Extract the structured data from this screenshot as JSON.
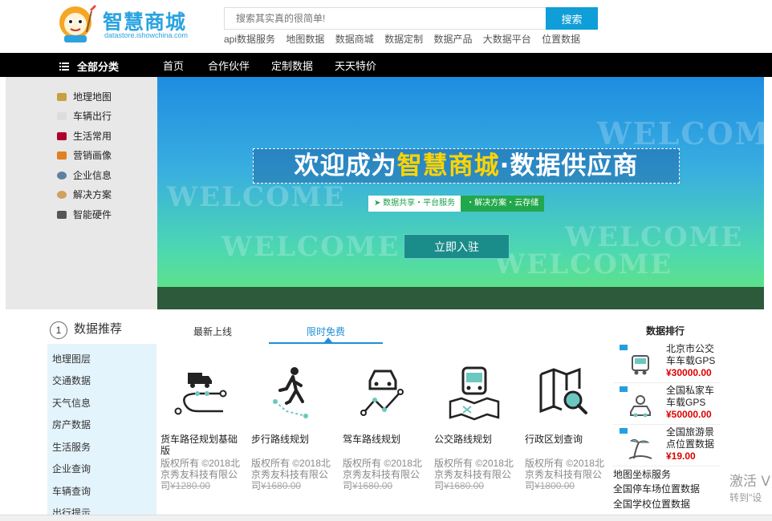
{
  "header": {
    "brand": "智慧商城",
    "domain": "datastore.ishowchina.com",
    "search_placeholder": "搜索其实真的很简单!",
    "search_button": "搜索",
    "hot_links": [
      "api数据服务",
      "地图数据",
      "数据商城",
      "数据定制",
      "数据产品",
      "大数据平台",
      "位置数据"
    ]
  },
  "nav": {
    "all_categories": "全部分类",
    "items": [
      "首页",
      "合作伙伴",
      "定制数据",
      "天天特价"
    ]
  },
  "categories": [
    {
      "label": "地理地图",
      "color": "#c8a040"
    },
    {
      "label": "车辆出行",
      "color": "#dddddd"
    },
    {
      "label": "生活常用",
      "color": "#b0002a"
    },
    {
      "label": "营销画像",
      "color": "#e08020"
    },
    {
      "label": "企业信息",
      "color": "#6080a0"
    },
    {
      "label": "解决方案",
      "color": "#d0a060"
    },
    {
      "label": "智能硬件",
      "color": "#555555"
    }
  ],
  "banner": {
    "watermark": "WELCOME",
    "headline_pre": "欢迎成为",
    "headline_highlight": "智慧商城",
    "headline_post": "·数据供应商",
    "tag_a": "➤ 数据共享・平台服务",
    "tag_b": "・解决方案・云存储",
    "join_button": "立即入驻"
  },
  "recommend": {
    "number": "1",
    "title": "数据推荐",
    "tabs": [
      "最新上线",
      "限时免费"
    ],
    "active_tab": 1,
    "subcategories": [
      "地理图层",
      "交通数据",
      "天气信息",
      "房产数据",
      "生活服务",
      "企业查询",
      "车辆查询",
      "出行提示"
    ],
    "products": [
      {
        "name": "货车路径规划基础版",
        "desc": "版权所有 ©2018北京秀友科技有限公司",
        "price": "¥1280.00",
        "icon": "truck-route-icon"
      },
      {
        "name": "步行路线规划",
        "desc": "版权所有 ©2018北京秀友科技有限公司",
        "price": "¥1680.00",
        "icon": "walking-route-icon"
      },
      {
        "name": "驾车路线规划",
        "desc": "版权所有 ©2018北京秀友科技有限公司",
        "price": "¥1680.00",
        "icon": "driving-route-icon"
      },
      {
        "name": "公交路线规划",
        "desc": "版权所有 ©2018北京秀友科技有限公司",
        "price": "¥1680.00",
        "icon": "bus-route-icon"
      },
      {
        "name": "行政区划查询",
        "desc": "版权所有 ©2018北京秀友科技有限公司",
        "price": "¥1800.00",
        "icon": "map-search-icon"
      }
    ]
  },
  "ranking": {
    "title": "数据排行",
    "items": [
      {
        "name": "北京市公交车车载GPS日...",
        "price": "¥30000.00",
        "icon": "bus-icon"
      },
      {
        "name": "全国私家车车载GPS日...",
        "price": "¥50000.00",
        "icon": "car-icon"
      },
      {
        "name": "全国旅游景点位置数据",
        "price": "¥19.00",
        "icon": "beach-icon"
      }
    ],
    "list": [
      "地图坐标服务",
      "全国停车场位置数据",
      "全国学校位置数据"
    ]
  },
  "overlay": {
    "activate_line1": "激活 V",
    "activate_line2": "转到\"设"
  }
}
